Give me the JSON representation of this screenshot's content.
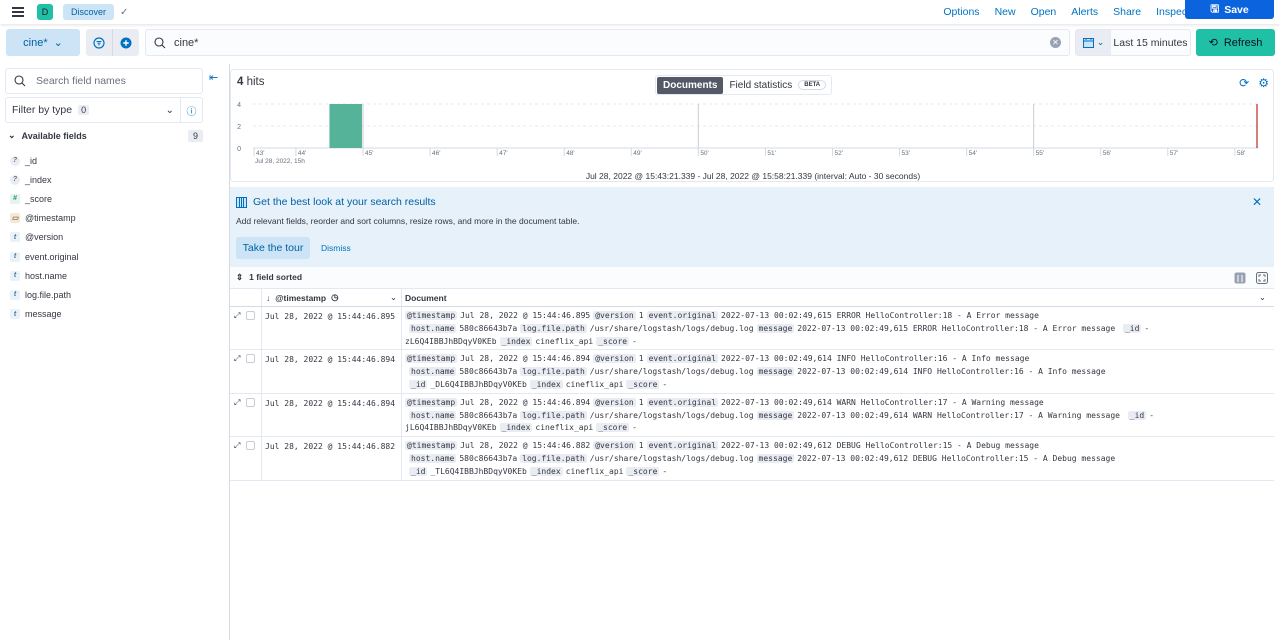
{
  "header": {
    "space_initial": "D",
    "breadcrumb": "Discover",
    "links": [
      "Options",
      "New",
      "Open",
      "Alerts",
      "Share",
      "Inspect"
    ],
    "save_label": "Save"
  },
  "query": {
    "data_view": "cine*",
    "search_value": "cine*",
    "time_range": "Last 15 minutes",
    "refresh_label": "Refresh"
  },
  "sidebar": {
    "search_placeholder": "Search field names",
    "filter_label": "Filter by type",
    "filter_count": "0",
    "available_label": "Available fields",
    "available_count": "9",
    "fields": [
      {
        "name": "_id",
        "type": "unknown"
      },
      {
        "name": "_index",
        "type": "unknown"
      },
      {
        "name": "_score",
        "type": "number"
      },
      {
        "name": "@timestamp",
        "type": "date"
      },
      {
        "name": "@version",
        "type": "string"
      },
      {
        "name": "event.original",
        "type": "string"
      },
      {
        "name": "host.name",
        "type": "string"
      },
      {
        "name": "log.file.path",
        "type": "string"
      },
      {
        "name": "message",
        "type": "string"
      }
    ]
  },
  "results": {
    "hits_count": "4",
    "hits_label": "hits",
    "tabs": [
      "Documents",
      "Field statistics"
    ],
    "beta_label": "BETA",
    "range_text": "Jul 28, 2022 @ 15:43:21.339 - Jul 28, 2022 @ 15:58:21.339 (interval: Auto - 30 seconds)"
  },
  "chart_data": {
    "type": "bar",
    "title": "",
    "xlabel": "",
    "ylabel": "",
    "x_ticks": [
      "43'",
      "44'",
      "45'",
      "46'",
      "47'",
      "48'",
      "49'",
      "50'",
      "51'",
      "52'",
      "53'",
      "54'",
      "55'",
      "56'",
      "57'",
      "58'"
    ],
    "x_sublabel": "Jul 28, 2022, 15h",
    "y_ticks": [
      "0",
      "2",
      "4"
    ],
    "ylim": [
      0,
      4
    ],
    "xlim_minutes": [
      43.36,
      58.36
    ],
    "bars": [
      {
        "start_minute": 44.5,
        "end_minute": 45.0,
        "value": 4
      }
    ],
    "bar_color": "#54b399",
    "now_marker_minute": 58.36,
    "grid": true
  },
  "callout": {
    "title": "Get the best look at your search results",
    "description": "Add relevant fields, reorder and sort columns, resize rows, and more in the document table.",
    "tour_label": "Take the tour",
    "dismiss_label": "Dismiss"
  },
  "grid": {
    "sorted_label": "1 field sorted",
    "col_timestamp": "@timestamp",
    "col_document": "Document",
    "rows": [
      {
        "timestamp": "Jul 28, 2022 @ 15:44:46.895",
        "lines": [
          [
            [
              "@timestamp",
              "Jul 28, 2022 @ 15:44:46.895"
            ],
            [
              "@version",
              "1"
            ],
            [
              "event.original",
              "2022-07-13 00:02:49,615 ERROR HelloController:18 - A Error message"
            ]
          ],
          [
            [
              "host.name",
              "580c86643b7a"
            ],
            [
              "log.file.path",
              "/usr/share/logstash/logs/debug.log"
            ],
            [
              "message",
              "2022-07-13 00:02:49,615 ERROR HelloController:18 - A Error message "
            ],
            [
              "_id",
              "-"
            ]
          ],
          [
            [
              "",
              "zL6Q4IBBJhBDqyV0KEb"
            ],
            [
              "_index",
              "cineflix_api"
            ],
            [
              "_score",
              "-"
            ]
          ]
        ]
      },
      {
        "timestamp": "Jul 28, 2022 @ 15:44:46.894",
        "lines": [
          [
            [
              "@timestamp",
              "Jul 28, 2022 @ 15:44:46.894"
            ],
            [
              "@version",
              "1"
            ],
            [
              "event.original",
              "2022-07-13 00:02:49,614 INFO HelloController:16 - A Info message"
            ]
          ],
          [
            [
              "host.name",
              "580c86643b7a"
            ],
            [
              "log.file.path",
              "/usr/share/logstash/logs/debug.log"
            ],
            [
              "message",
              "2022-07-13 00:02:49,614 INFO HelloController:16 - A Info message"
            ]
          ],
          [
            [
              "_id",
              "_DL6Q4IBBJhBDqyV0KEb"
            ],
            [
              "_index",
              "cineflix_api"
            ],
            [
              "_score",
              "-"
            ]
          ]
        ]
      },
      {
        "timestamp": "Jul 28, 2022 @ 15:44:46.894",
        "lines": [
          [
            [
              "@timestamp",
              "Jul 28, 2022 @ 15:44:46.894"
            ],
            [
              "@version",
              "1"
            ],
            [
              "event.original",
              "2022-07-13 00:02:49,614 WARN HelloController:17 - A Warning message"
            ]
          ],
          [
            [
              "host.name",
              "580c86643b7a"
            ],
            [
              "log.file.path",
              "/usr/share/logstash/logs/debug.log"
            ],
            [
              "message",
              "2022-07-13 00:02:49,614 WARN HelloController:17 - A Warning message "
            ],
            [
              "_id",
              "-"
            ]
          ],
          [
            [
              "",
              "jL6Q4IBBJhBDqyV0KEb"
            ],
            [
              "_index",
              "cineflix_api"
            ],
            [
              "_score",
              "-"
            ]
          ]
        ]
      },
      {
        "timestamp": "Jul 28, 2022 @ 15:44:46.882",
        "lines": [
          [
            [
              "@timestamp",
              "Jul 28, 2022 @ 15:44:46.882"
            ],
            [
              "@version",
              "1"
            ],
            [
              "event.original",
              "2022-07-13 00:02:49,612 DEBUG HelloController:15 - A Debug message"
            ]
          ],
          [
            [
              "host.name",
              "580c86643b7a"
            ],
            [
              "log.file.path",
              "/usr/share/logstash/logs/debug.log"
            ],
            [
              "message",
              "2022-07-13 00:02:49,612 DEBUG HelloController:15 - A Debug message"
            ]
          ],
          [
            [
              "_id",
              "_TL6Q4IBBJhBDqyV0KEb"
            ],
            [
              "_index",
              "cineflix_api"
            ],
            [
              "_score",
              "-"
            ]
          ]
        ]
      }
    ]
  }
}
